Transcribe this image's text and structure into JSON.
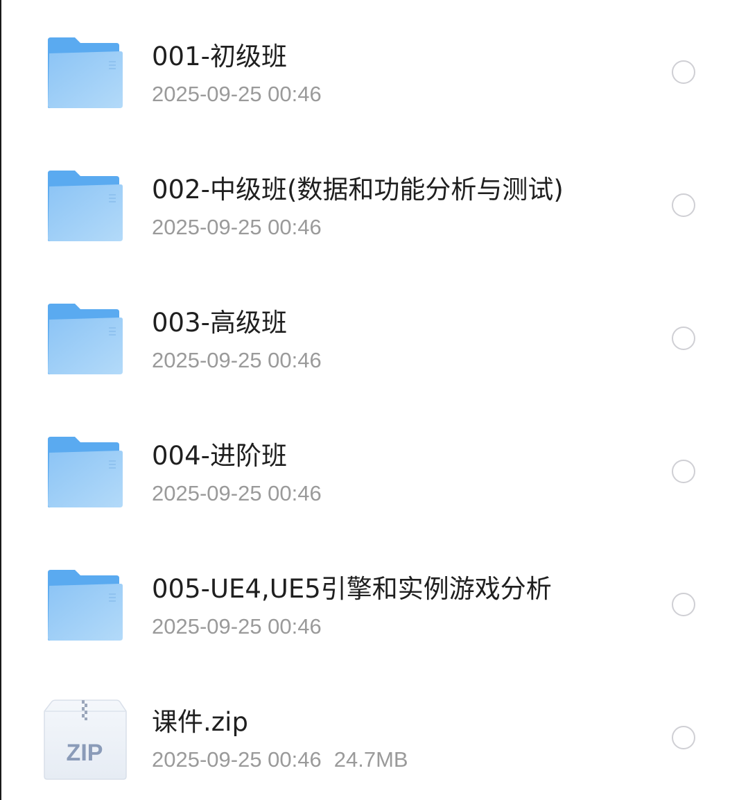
{
  "files": [
    {
      "name": "001-初级班",
      "meta": "2025-09-25 00:46",
      "size": "",
      "type": "folder"
    },
    {
      "name": "002-中级班(数据和功能分析与测试)",
      "meta": "2025-09-25 00:46",
      "size": "",
      "type": "folder"
    },
    {
      "name": "003-高级班",
      "meta": "2025-09-25 00:46",
      "size": "",
      "type": "folder"
    },
    {
      "name": "004-进阶班",
      "meta": "2025-09-25 00:46",
      "size": "",
      "type": "folder"
    },
    {
      "name": "005-UE4,UE5引擎和实例游戏分析",
      "meta": "2025-09-25 00:46",
      "size": "",
      "type": "folder"
    },
    {
      "name": "课件.zip",
      "meta": "2025-09-25 00:46",
      "size": "24.7MB",
      "type": "zip",
      "icon_label": "ZIP"
    }
  ],
  "colors": {
    "folder_back": "#5aaaf0",
    "folder_front": "#9fcdf7",
    "zip_label": "#8a9bb8",
    "name_text": "#1f1f1f",
    "meta_text": "#9a9a9a"
  },
  "icons": {
    "folder": "folder-icon",
    "zip": "zip-file-icon",
    "select": "radio-circle-icon"
  }
}
